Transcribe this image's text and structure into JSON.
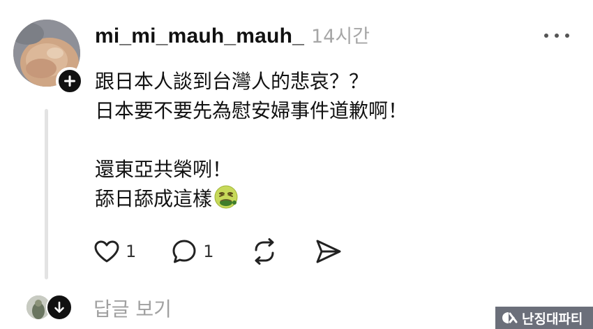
{
  "post": {
    "username": "mi_mi_mauh_mauh_",
    "timestamp": "14시간",
    "body": {
      "line1": "跟日本人談到台灣人的悲哀？？",
      "line2": "日本要不要先為慰安婦事件道歉啊！",
      "line3": "還東亞共榮咧！",
      "line4": "舔日舔成這樣",
      "line4_emoji": "nauseated-face-emoji"
    },
    "likes_count": "1",
    "replies_count": "1"
  },
  "replies": {
    "view_label": "답글 보기"
  },
  "watermark": {
    "text": "난징대파티"
  },
  "icons": {
    "more": "more-horizontal-icon",
    "follow": "plus-icon",
    "like": "heart-icon",
    "reply": "comment-icon",
    "repost": "repost-icon",
    "share": "send-icon",
    "expand": "arrow-down-icon"
  },
  "colors": {
    "text": "#111111",
    "muted": "#a6a6a6",
    "thread_line": "#e3e3e3",
    "watermark_bg": "#6b6f7a"
  }
}
